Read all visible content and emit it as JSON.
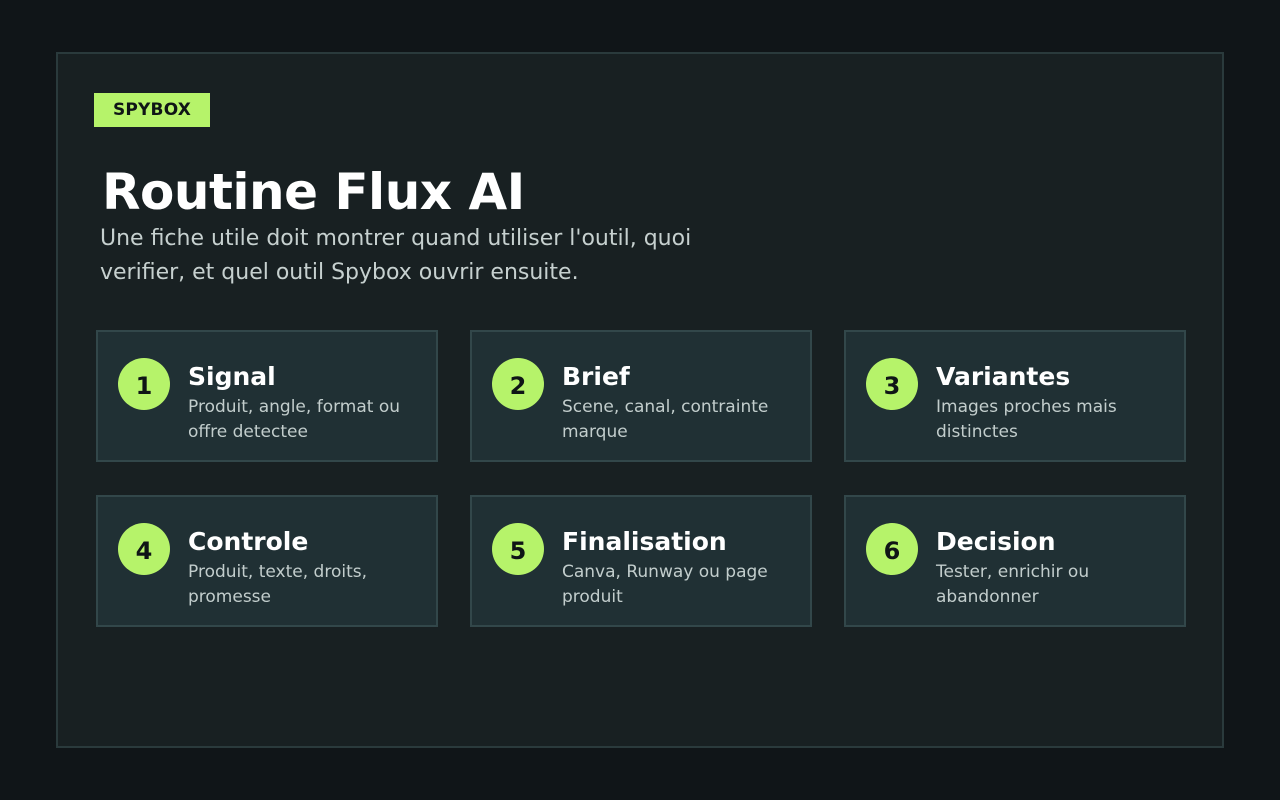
{
  "brand": {
    "label": "SPYBOX"
  },
  "header": {
    "title": "Routine Flux AI",
    "subtitle": "Une fiche utile doit montrer quand utiliser l'outil, quoi verifier, et quel outil Spybox ouvrir ensuite."
  },
  "steps": [
    {
      "number": "1",
      "title": "Signal",
      "desc": "Produit, angle, format ou offre detectee"
    },
    {
      "number": "2",
      "title": "Brief",
      "desc": "Scene, canal, contrainte marque"
    },
    {
      "number": "3",
      "title": "Variantes",
      "desc": "Images proches mais distinctes"
    },
    {
      "number": "4",
      "title": "Controle",
      "desc": "Produit, texte, droits, promesse"
    },
    {
      "number": "5",
      "title": "Finalisation",
      "desc": "Canva, Runway ou page produit"
    },
    {
      "number": "6",
      "title": "Decision",
      "desc": "Tester, enrichir ou abandonner"
    }
  ],
  "colors": {
    "accent": "#b6f36a",
    "background": "#101518",
    "panel": "#182022",
    "card": "#203034"
  }
}
